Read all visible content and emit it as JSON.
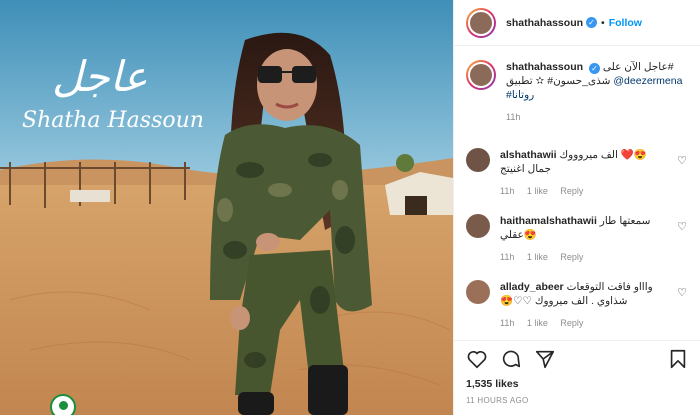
{
  "post": {
    "overlay_arabic": "عاجل",
    "overlay_latin": "Shatha Hassoun"
  },
  "header": {
    "username": "shathahassoun",
    "verified_glyph": "✓",
    "separator": "•",
    "follow_label": "Follow"
  },
  "caption": {
    "username": "shathahassoun",
    "text_line1": "عاجل الآن على#",
    "text_line2_a": "شذى_حسون# ✫ تطبيق ",
    "mention": "@deezermena",
    "text_line3": "#روتانا",
    "time": "11h"
  },
  "comments": [
    {
      "username": "alshathawii",
      "text_a": "الف ميروووك ❤️😍",
      "text_b": "جمال اغنيتج",
      "time": "11h",
      "likes": "1 like",
      "reply": "Reply"
    },
    {
      "username": "haithamalshathawii",
      "text_a": "سمعتها طار",
      "text_b": "عقلي😍",
      "time": "11h",
      "likes": "1 like",
      "reply": "Reply"
    },
    {
      "username": "allady_abeer",
      "text_a": "واااو فاقت التوقعات",
      "text_b": "😍♡♡ شذاوي . الف ميرووك",
      "time": "11h",
      "likes": "1 like",
      "reply": "Reply"
    }
  ],
  "stats": {
    "likes": "1,535 likes",
    "posted": "11 HOURS AGO"
  },
  "icons": [
    "heart-icon",
    "comment-icon",
    "share-icon",
    "bookmark-icon",
    "verified-icon"
  ],
  "colors": {
    "accent": "#0095f6",
    "verified": "#3897f0",
    "sky": "#5aa6c8",
    "sand": "#d9a56a"
  }
}
